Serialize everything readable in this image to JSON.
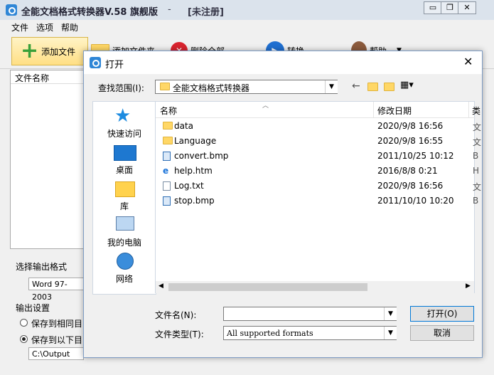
{
  "main_window": {
    "title": "全能文档格式转换器V.58 旗舰版",
    "title_separator": "-",
    "registration": "[未注册]",
    "controls": {
      "minimize": "▭",
      "restore": "❐",
      "close": "✕"
    }
  },
  "menu": [
    "文件",
    "选项",
    "帮助"
  ],
  "toolbar": {
    "add_file": "添加文件",
    "add_folder": "添加文件夹",
    "delete_all": "删除全部",
    "convert": "转换",
    "help": "帮助"
  },
  "file_list": {
    "header": "文件名称"
  },
  "output_format": {
    "label": "选择输出格式",
    "value": "Word 97-2003"
  },
  "output_settings": {
    "label": "输出设置",
    "radio_same": "保存到相同目",
    "radio_below": "保存到以下目",
    "path": "C:\\Output"
  },
  "dialog": {
    "title": "打开",
    "look_in_label": "查找范围(I):",
    "look_in_value": "全能文档格式转换器",
    "places": [
      {
        "label": "快速访问",
        "icon": "star-icon"
      },
      {
        "label": "桌面",
        "icon": "desktop-icon"
      },
      {
        "label": "库",
        "icon": "library-icon"
      },
      {
        "label": "我的电脑",
        "icon": "computer-icon"
      },
      {
        "label": "网络",
        "icon": "network-icon"
      }
    ],
    "columns": {
      "name": "名称",
      "date": "修改日期",
      "extra": "类"
    },
    "files": [
      {
        "name": "data",
        "date": "2020/9/8 16:56",
        "extra": "文",
        "icon": "folder-icon"
      },
      {
        "name": "Language",
        "date": "2020/9/8 16:55",
        "extra": "文",
        "icon": "folder-icon"
      },
      {
        "name": "convert.bmp",
        "date": "2011/10/25 10:12",
        "extra": "B",
        "icon": "image-icon"
      },
      {
        "name": "help.htm",
        "date": "2016/8/8 0:21",
        "extra": "H",
        "icon": "ie-icon"
      },
      {
        "name": "Log.txt",
        "date": "2020/9/8 16:56",
        "extra": "文",
        "icon": "text-file-icon"
      },
      {
        "name": "stop.bmp",
        "date": "2011/10/10 10:20",
        "extra": "B",
        "icon": "image-icon"
      }
    ],
    "filename_label": "文件名(N):",
    "filename_value": "",
    "filetype_label": "文件类型(T):",
    "filetype_value": "All supported formats",
    "open_button": "打开(O)",
    "cancel_button": "取消"
  }
}
